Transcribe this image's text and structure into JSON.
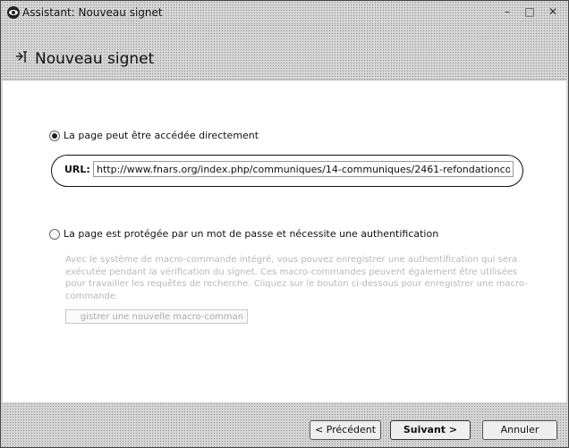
{
  "window": {
    "title": "Assistant: Nouveau signet",
    "controls": {
      "minimize": "–",
      "maximize": "□",
      "close": "✕"
    }
  },
  "header": {
    "title": "Nouveau signet",
    "icon": "bookmark-pin-icon"
  },
  "options": {
    "direct": {
      "label": "La page peut être accédée directement",
      "selected": true
    },
    "url": {
      "label": "URL:",
      "value": "http://www.fnars.org/index.php/communiques/14-communiques/2461-refondationco"
    },
    "protected": {
      "label": "La page est protégée par un mot de passe et nécessite une authentification",
      "selected": false
    },
    "description": "Avec le système de macro-commande intégré, vous pouvez enregistrer une authentification qui sera exécutée pendant la vérification du signet. Ces macro-commandes peuvent également être utilisées pour travailler les requêtes de recherche. Cliquez sur le bouton ci-dessous pour enregistrer une macro-commande.",
    "macro_button": "gistrer une nouvelle macro-comman"
  },
  "footer": {
    "prev": "< Précédent",
    "next": "Suivant >",
    "cancel": "Annuler"
  }
}
